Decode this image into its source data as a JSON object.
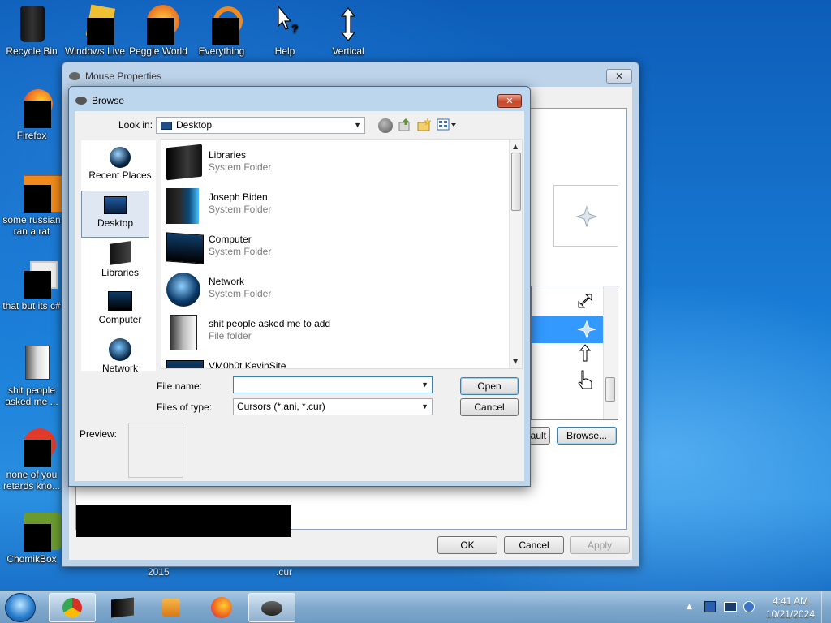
{
  "desktop": {
    "icons": [
      {
        "label": "Recycle Bin"
      },
      {
        "label": "Windows Live"
      },
      {
        "label": "Peggle World"
      },
      {
        "label": "Everything"
      },
      {
        "label": "Help"
      },
      {
        "label": "Vertical"
      },
      {
        "label": "Firefox"
      },
      {
        "label": "some russian ran a rat"
      },
      {
        "label": "that but its c#"
      },
      {
        "label": "shit people asked me ..."
      },
      {
        "label": "none of you retards kno..."
      },
      {
        "label": "ChomikBox"
      }
    ],
    "bottom_labels": [
      "2015",
      ".cur"
    ]
  },
  "mouse_properties": {
    "title": "Mouse Properties",
    "close_glyph": "✕",
    "browse_button": "Browse...",
    "default_button_partial": "ault",
    "ok": "OK",
    "cancel": "Cancel",
    "apply": "Apply"
  },
  "browse": {
    "title": "Browse",
    "close_glyph": "✕",
    "look_in_label": "Look in:",
    "look_in_value": "Desktop",
    "places": [
      "Recent Places",
      "Desktop",
      "Libraries",
      "Computer",
      "Network"
    ],
    "selected_place": "Desktop",
    "files": [
      {
        "name": "Libraries",
        "type": "System Folder"
      },
      {
        "name": "Joseph Biden",
        "type": "System Folder"
      },
      {
        "name": "Computer",
        "type": "System Folder"
      },
      {
        "name": "Network",
        "type": "System Folder"
      },
      {
        "name": "shit people asked me to add",
        "type": "File folder"
      },
      {
        "name": "VM0h0t KevinSite",
        "type": ""
      }
    ],
    "file_name_label": "File name:",
    "file_name_value": "",
    "files_of_type_label": "Files of type:",
    "files_of_type_value": "Cursors (*.ani, *.cur)",
    "open": "Open",
    "cancel": "Cancel",
    "preview_label": "Preview:"
  },
  "taskbar": {
    "time": "4:41 AM",
    "date": "10/21/2024"
  },
  "colors": {
    "desktop": "#1b6fc4",
    "selection": "#3399ff"
  }
}
